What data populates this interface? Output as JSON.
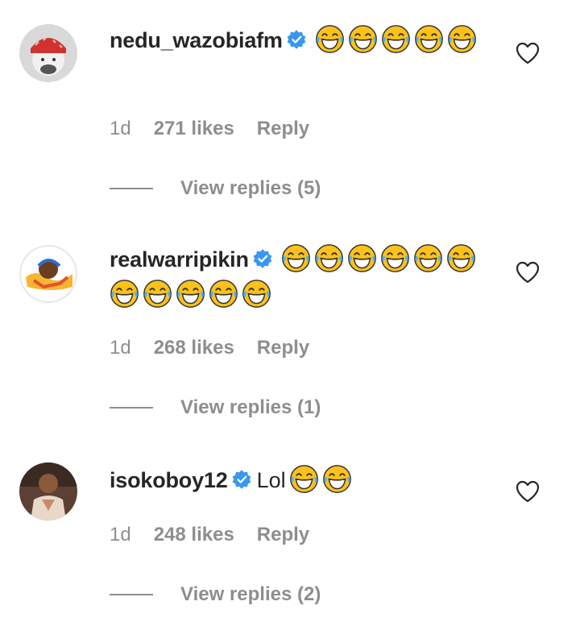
{
  "colors": {
    "text": "#262626",
    "muted": "#8e8e8e",
    "verified": "#3897f0",
    "emoji_face": "#fcc21b",
    "emoji_tear": "#4fb3f6"
  },
  "comments": [
    {
      "username": "nedu_wazobiafm",
      "verified": true,
      "text": "",
      "emoji_count": 5,
      "emoji_name": "face-with-tears-of-joy",
      "time": "1d",
      "likes": "271 likes",
      "reply_label": "Reply",
      "view_replies": "View replies (5)"
    },
    {
      "username": "realwarripikin",
      "verified": true,
      "text": "",
      "emoji_count": 11,
      "emoji_name": "face-with-tears-of-joy",
      "time": "1d",
      "likes": "268 likes",
      "reply_label": "Reply",
      "view_replies": "View replies (1)"
    },
    {
      "username": "isokoboy12",
      "verified": true,
      "text": "Lol",
      "emoji_count": 2,
      "emoji_name": "face-with-tears-of-joy",
      "time": "1d",
      "likes": "248 likes",
      "reply_label": "Reply",
      "view_replies": "View replies (2)"
    }
  ]
}
